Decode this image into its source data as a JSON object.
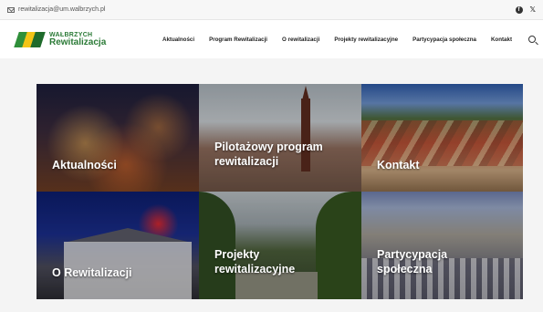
{
  "topbar": {
    "email": "rewitalizacja@um.walbrzych.pl",
    "social": [
      {
        "icon": "facebook-icon",
        "glyph": "f"
      },
      {
        "icon": "twitter-icon",
        "glyph": "𝕏"
      }
    ]
  },
  "header": {
    "logo": {
      "top": "WAŁBRZYCH",
      "bottom": "Rewitalizacja"
    },
    "nav": [
      "Aktualności",
      "Program Rewitalizacji",
      "O rewitalizacji",
      "Projekty rewitalizacyjne",
      "Partycypacja społeczna",
      "Kontakt"
    ]
  },
  "tiles": [
    {
      "label_1": "Aktualności",
      "label_2": ""
    },
    {
      "label_1": "Pilotażowy program",
      "label_2": "rewitalizacji"
    },
    {
      "label_1": "Kontakt",
      "label_2": ""
    },
    {
      "label_1": "O Rewitalizacji",
      "label_2": ""
    },
    {
      "label_1": "Projekty",
      "label_2": "rewitalizacyjne"
    },
    {
      "label_1": "Partycypacja",
      "label_2": "społeczna"
    }
  ],
  "colors": {
    "brand_green": "#2a7a36",
    "brand_yellow": "#f2c417"
  }
}
